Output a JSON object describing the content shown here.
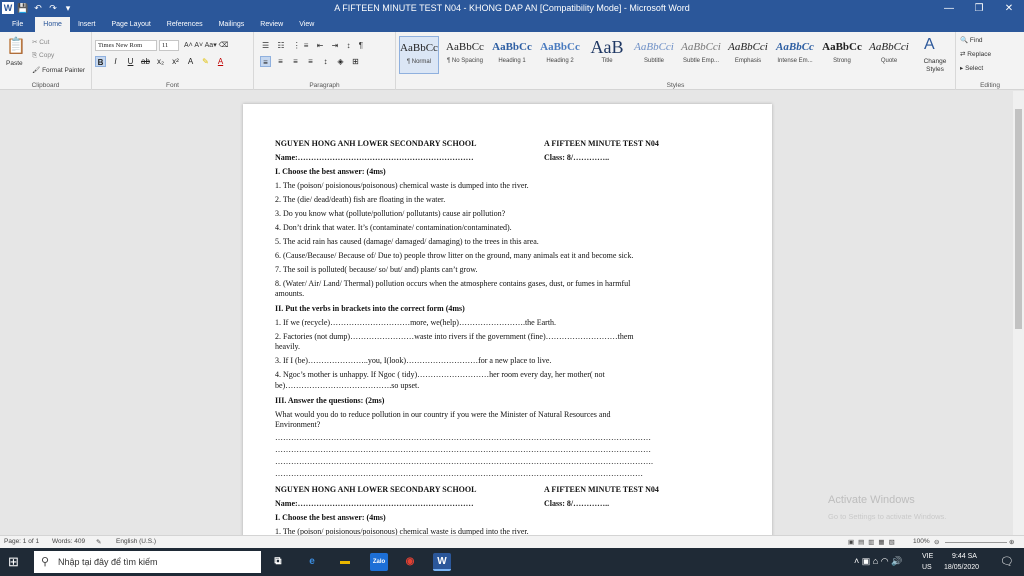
{
  "window": {
    "title": "A FIFTEEN MINUTE TEST N04 - KHONG DAP AN [Compatibility Mode] - Microsoft Word",
    "qat": [
      "W",
      "💾",
      "↶",
      "↷",
      "▾"
    ],
    "minimize": "—",
    "maximize": "❐",
    "close": "✕"
  },
  "tabs": [
    "File",
    "Home",
    "Insert",
    "Page Layout",
    "References",
    "Mailings",
    "Review",
    "View"
  ],
  "ribbon": {
    "clipboard": {
      "paste": "Paste",
      "cut": "Cut",
      "copy": "Copy",
      "format_painter": "Format Painter",
      "label": "Clipboard"
    },
    "font": {
      "name": "Times New Rom",
      "size": "11",
      "label": "Font"
    },
    "paragraph": {
      "label": "Paragraph"
    },
    "styles": {
      "label": "Styles",
      "items": [
        {
          "sample": "AaBbCc",
          "name": "¶ Normal"
        },
        {
          "sample": "AaBbCc",
          "name": "¶ No Spacing"
        },
        {
          "sample": "AaBbCc",
          "name": "Heading 1"
        },
        {
          "sample": "AaBbCc",
          "name": "Heading 2"
        },
        {
          "sample": "AaB",
          "name": "Title"
        },
        {
          "sample": "AaBbCci",
          "name": "Subtitle"
        },
        {
          "sample": "AaBbCci",
          "name": "Subtle Emp..."
        },
        {
          "sample": "AaBbCci",
          "name": "Emphasis"
        },
        {
          "sample": "AaBbCc",
          "name": "Intense Em..."
        },
        {
          "sample": "AaBbCc",
          "name": "Strong"
        },
        {
          "sample": "AaBbCci",
          "name": "Quote"
        }
      ],
      "change_styles": "Change Styles"
    },
    "editing": {
      "find": "Find",
      "replace": "Replace",
      "select": "Select",
      "label": "Editing"
    }
  },
  "document": {
    "school": "NGUYEN HONG ANH LOWER SECONDARY SCHOOL",
    "test": "A FIFTEEN MINUTE TEST N04",
    "name": "Name:…………………………………………………………",
    "class": "Class: 8/…………..",
    "s1": "I. Choose the best answer: (4ms)",
    "q1": "1. The (poison/ poisionous/poisonous)  chemical waste is dumped into the river.",
    "q2": "2. The (die/ dead/death) fish are floating in the water.",
    "q3": "3. Do you know what (pollute/pollution/ pollutants) cause air pollution?",
    "q4": "4. Don’t drink that water. It’s (contaminate/ contamination/contaminated).",
    "q5": "5. The acid rain has caused (damage/ damaged/ damaging)  to the trees in this area.",
    "q6": "6. (Cause/Because/ Because of/ Due to) people throw litter on the ground, many animals eat it and become sick.",
    "q7": "7. The soil is polluted( because/ so/ but/ and) plants can’t grow.",
    "q8a": "8. (Water/ Air/ Land/ Thermal) pollution occurs when the atmosphere contains gases, dust, or fumes in harmful",
    "q8b": "amounts.",
    "s2": "II. Put the verbs in brackets into the correct form (4ms)",
    "v1": "1. If we (recycle)…………………………more,  we(help)…………………….the  Earth.",
    "v2a": "2. Factories (not dump)……………………waste  into rivers if the government (fine)………………………them",
    "v2b": "heavily.",
    "v3": "3. If I (be)…………………..you, I(look)………………………for  a new place to live.",
    "v4a": "4. Ngoc’s mother is unhappy. If Ngoc ( tidy)………………………her  room every day, her mother( not",
    "v4b": "be)………………………………….so  upset.",
    "s3": "III. Answer the questions: (2ms)",
    "a1": "What would you do to reduce pollution in our country if you were the Minister of Natural Resources and",
    "a2": "Environment?",
    "dots1": "……………………………………………………………………………………………………………………………",
    "dots2": "……………………………………………………………………………………………………………………………",
    "dots3": "…………………………………………………………………………………………………………………………….",
    "dots4": "…………………………………………………………………………………………………………………………",
    "school2": "NGUYEN HONG ANH LOWER SECONDARY SCHOOL",
    "test2": "A FIFTEEN MINUTE TEST N04",
    "name2": "Name:…………………………………………………………",
    "class2": "Class: 8/…………..",
    "s1b": "I. Choose the best answer: (4ms)",
    "q1b": "1. The (poison/ poisionous/poisonous)  chemical waste is dumped into the river."
  },
  "status": {
    "page": "Page: 1 of 1",
    "words": "Words: 409",
    "lang": "English (U.S.)",
    "zoom": "100%"
  },
  "watermark": {
    "line1": "Activate Windows",
    "line2": "Go to Settings to activate Windows."
  },
  "taskbar": {
    "search": "Nhập tại đây để tìm kiếm",
    "lang1": "VIE",
    "lang2": "US",
    "time": "9:44 SA",
    "date": "18/05/2020"
  },
  "colors": {
    "word_blue": "#2b579a",
    "taskbar": "#1f2a36"
  }
}
